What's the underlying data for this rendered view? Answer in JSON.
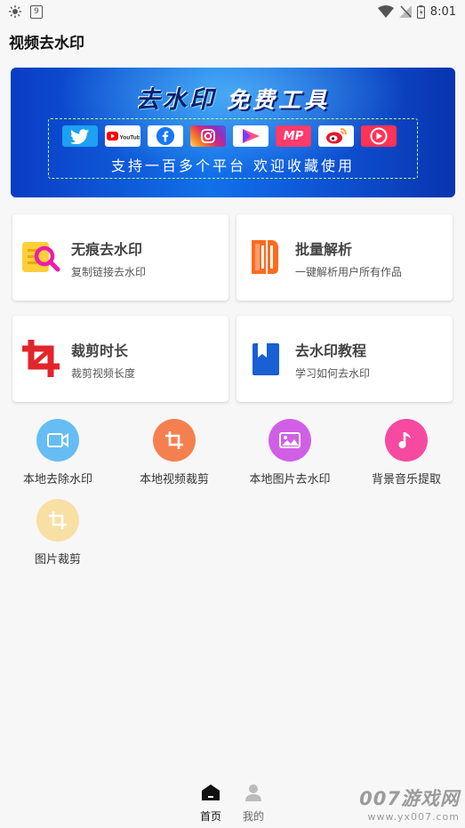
{
  "status_bar": {
    "time": "8:01",
    "notification_count": "9"
  },
  "app": {
    "title": "视频去水印"
  },
  "banner": {
    "headline_left": "去水印",
    "headline_right": "免费工具",
    "tagline": "支持一百多个平台 欢迎收藏使用",
    "logos": [
      {
        "name": "twitter-logo",
        "text": "",
        "bg": "#1da1f2"
      },
      {
        "name": "youtube-logo",
        "text": "YouTube",
        "bg": "#ffffff"
      },
      {
        "name": "facebook-logo",
        "text": "f",
        "bg": "#1877f2"
      },
      {
        "name": "instagram-logo",
        "text": "",
        "bg": "#e1306c"
      },
      {
        "name": "play-logo",
        "text": "",
        "bg": "#ffffff"
      },
      {
        "name": "mp-logo",
        "text": "MP",
        "bg": "#ff3b6b"
      },
      {
        "name": "weibo-logo",
        "text": "",
        "bg": "#ffb400"
      },
      {
        "name": "video-logo",
        "text": "",
        "bg": "#ff3355"
      }
    ]
  },
  "cards": [
    {
      "title": "无痕去水印",
      "subtitle": "复制链接去水印"
    },
    {
      "title": "批量解析",
      "subtitle": "一键解析用户所有作品"
    },
    {
      "title": "裁剪时长",
      "subtitle": "裁剪视频长度"
    },
    {
      "title": "去水印教程",
      "subtitle": "学习如何去水印"
    }
  ],
  "tools": [
    {
      "label": "本地去除水印",
      "color": "#66bdf4"
    },
    {
      "label": "本地视频裁剪",
      "color": "#f5804f"
    },
    {
      "label": "本地图片去水印",
      "color": "#d05fe6"
    },
    {
      "label": "背景音乐提取",
      "color": "#f54aa0"
    },
    {
      "label": "图片裁剪",
      "color": "#f8dfa4"
    }
  ],
  "bottom_nav": [
    {
      "label": "首页",
      "active": true
    },
    {
      "label": "我的",
      "active": false
    }
  ],
  "watermark": {
    "line1": "007游戏网",
    "line2": "www.yx007.com"
  },
  "colors": {
    "accent_orange": "#ff6a1f",
    "accent_red": "#e2252b",
    "accent_blue": "#1a5fd3",
    "magenta": "#ef1ba8",
    "yellow": "#ffcf3a"
  }
}
